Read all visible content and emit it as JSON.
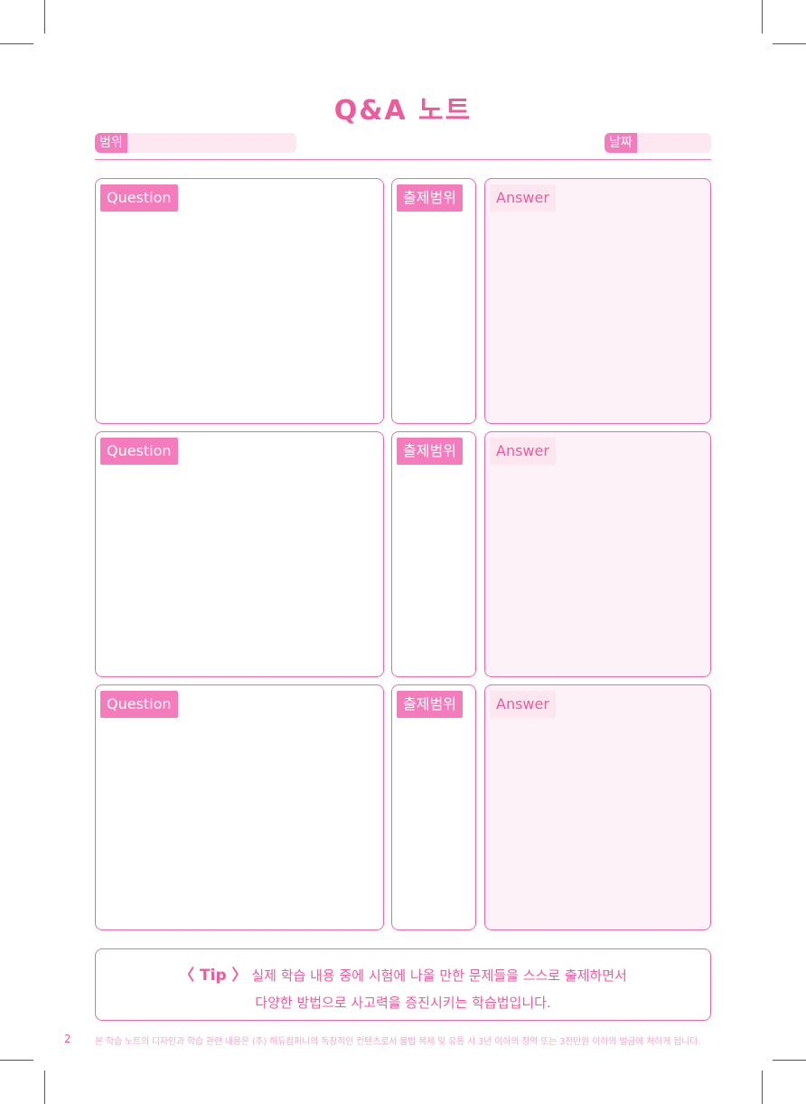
{
  "title": "Q&A 노트",
  "fields": {
    "range_label": "범위",
    "date_label": "날짜"
  },
  "sections": [
    {
      "question": "Question",
      "range": "출제범위",
      "answer": "Answer"
    },
    {
      "question": "Question",
      "range": "출제범위",
      "answer": "Answer"
    },
    {
      "question": "Question",
      "range": "출제범위",
      "answer": "Answer"
    }
  ],
  "tip": {
    "label": "〈 Tip 〉",
    "line1": "실제 학습 내용 중에 시험에 나올 만한 문제들을 스스로 출제하면서",
    "line2": "다양한 방법으로 사고력을 증진시키는 학습법입니다."
  },
  "page_number": "2",
  "footer": "본 학습 노트의 디자인과 학습 관련 내용은 (주) 해듀컴퍼니의 독창적인 컨텐츠로서 불법 복제 및 유통 시 3년 이하의 징역 또는 3천만원 이하의 벌금에 처하게 됩니다."
}
